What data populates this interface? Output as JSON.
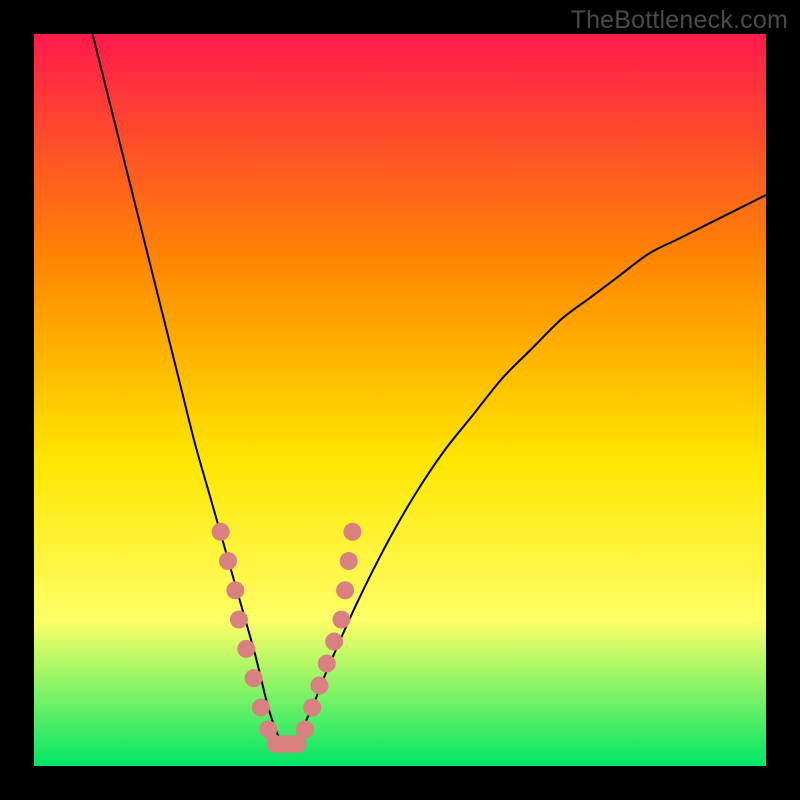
{
  "watermark": "TheBottleneck.com",
  "chart_data": {
    "type": "line",
    "title": "",
    "xlabel": "",
    "ylabel": "",
    "xlim": [
      0,
      100
    ],
    "ylim": [
      0,
      100
    ],
    "background_gradient": {
      "top": "#ff1a4d",
      "mid_upper": "#ff8a00",
      "mid": "#ffe600",
      "mid_lower": "#ffff66",
      "bottom": "#00e666"
    },
    "series": [
      {
        "name": "bottleneck-curve",
        "color": "#000000",
        "stroke_width": 2,
        "x": [
          8,
          10,
          12,
          14,
          16,
          18,
          20,
          22,
          24,
          26,
          28,
          30,
          31,
          32,
          33,
          34,
          35,
          36,
          38,
          40,
          44,
          48,
          52,
          56,
          60,
          64,
          68,
          72,
          76,
          80,
          84,
          88,
          92,
          96,
          100
        ],
        "y": [
          100,
          92,
          84,
          76,
          68,
          60,
          52,
          44,
          37,
          30,
          23,
          16,
          12,
          8,
          5,
          3,
          3,
          4,
          8,
          13,
          22,
          30,
          37,
          43,
          48,
          53,
          57,
          61,
          64,
          67,
          70,
          72,
          74,
          76,
          78
        ]
      }
    ],
    "highlight_points": {
      "name": "marker-dots",
      "color": "#d98080",
      "radius": 9,
      "points": [
        {
          "x": 25.5,
          "y": 32
        },
        {
          "x": 26.5,
          "y": 28
        },
        {
          "x": 27.5,
          "y": 24
        },
        {
          "x": 28.0,
          "y": 20
        },
        {
          "x": 29.0,
          "y": 16
        },
        {
          "x": 30.0,
          "y": 12
        },
        {
          "x": 31.0,
          "y": 8
        },
        {
          "x": 32.0,
          "y": 5
        },
        {
          "x": 33.0,
          "y": 3
        },
        {
          "x": 34.0,
          "y": 3
        },
        {
          "x": 35.0,
          "y": 3
        },
        {
          "x": 36.0,
          "y": 3
        },
        {
          "x": 37.0,
          "y": 5
        },
        {
          "x": 38.0,
          "y": 8
        },
        {
          "x": 39.0,
          "y": 11
        },
        {
          "x": 40.0,
          "y": 14
        },
        {
          "x": 41.0,
          "y": 17
        },
        {
          "x": 42.0,
          "y": 20
        },
        {
          "x": 42.5,
          "y": 24
        },
        {
          "x": 43.0,
          "y": 28
        },
        {
          "x": 43.5,
          "y": 32
        }
      ]
    }
  }
}
